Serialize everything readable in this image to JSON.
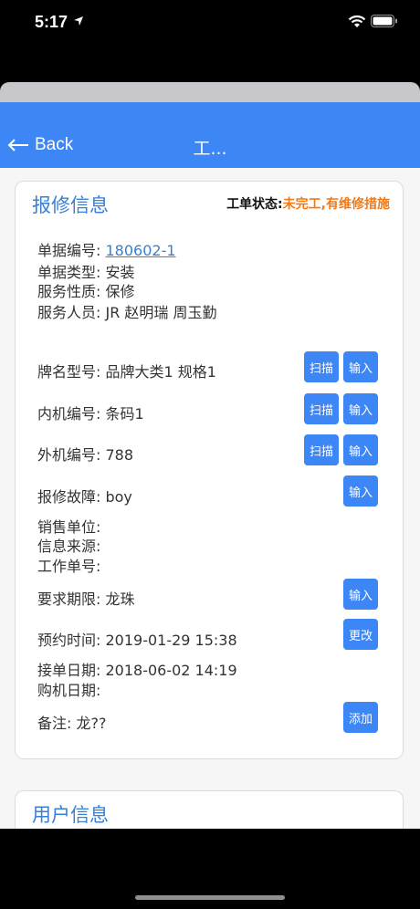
{
  "status_bar": {
    "time": "5:17"
  },
  "nav": {
    "back_label": "Back",
    "title": "工..."
  },
  "repair_card": {
    "title": "报修信息",
    "status_label": "工单状态:",
    "status_value": "未完工,有维修措施",
    "doc_no_label": "单据编号: ",
    "doc_no_value": "180602-1",
    "doc_type": "单据类型: 安装",
    "service_nature": "服务性质: 保修",
    "service_staff": "服务人员: JR 赵明瑞 周玉勤",
    "brand_model": "牌名型号: 品牌大类1 规格1",
    "inner_no": "内机编号: 条码1",
    "outer_no": "外机编号: 788",
    "fault": "报修故障: boy",
    "sales_unit": "销售单位:",
    "info_source": "信息来源:",
    "work_no": "工作单号:",
    "deadline": "要求期限: 龙珠",
    "appointment": "预约时间: 2019-01-29 15:38",
    "accept_date": "接单日期: 2018-06-02 14:19",
    "purchase_date": "购机日期:",
    "remark": "备注: 龙??",
    "scan_label": "扫描",
    "input_label": "输入",
    "change_label": "更改",
    "add_label": "添加"
  },
  "user_card": {
    "title": "用户信息"
  }
}
